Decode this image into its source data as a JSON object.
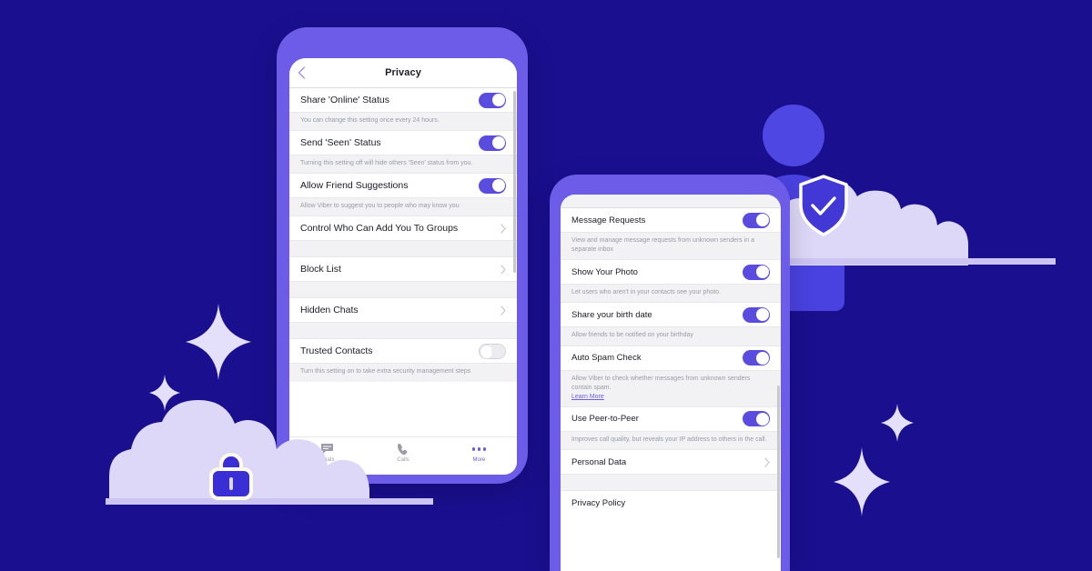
{
  "theme": {
    "background": "#1a0f8f",
    "phone_frame": "#6c5ce7",
    "accent": "#5b4ce0",
    "cloud": "#ddd8f7",
    "avatar": "#4f47e3",
    "link": "#6c5ce7"
  },
  "decorations": {
    "shield_icon": "shield-check-icon",
    "lock_icon": "lock-icon",
    "avatar_icon": "person-avatar-icon",
    "cloud_left": "cloud-shape",
    "cloud_right": "cloud-shape",
    "sparkles": [
      "sparkle-large-left",
      "sparkle-small-left",
      "sparkle-large-right",
      "sparkle-small-right"
    ]
  },
  "phone_one": {
    "header": {
      "back_icon": "chevron-left-icon",
      "title": "Privacy"
    },
    "rows": [
      {
        "type": "toggle",
        "label": "Share 'Online' Status",
        "state": "on",
        "desc": "You can change this setting once every 24 hours."
      },
      {
        "type": "toggle",
        "label": "Send 'Seen' Status",
        "state": "on",
        "desc": "Turning this setting off will hide others 'Seen' status from you."
      },
      {
        "type": "toggle",
        "label": "Allow Friend Suggestions",
        "state": "on",
        "desc": "Allow Viber to suggest you to people who may know you"
      },
      {
        "type": "link",
        "label": "Control Who Can Add You To Groups",
        "desc": ""
      },
      {
        "type": "link",
        "label": "Block List",
        "desc": ""
      },
      {
        "type": "link",
        "label": "Hidden Chats",
        "desc": ""
      },
      {
        "type": "toggle",
        "label": "Trusted Contacts",
        "state": "off",
        "desc": "Turn this setting on to take extra security management steps"
      }
    ],
    "tabbar": [
      {
        "label": "Chats",
        "icon": "chat-bubble-icon",
        "active": false
      },
      {
        "label": "Calls",
        "icon": "phone-handset-icon",
        "active": false
      },
      {
        "label": "More",
        "icon": "more-dots-icon",
        "active": true
      }
    ]
  },
  "phone_two": {
    "rows": [
      {
        "type": "toggle",
        "label": "Message Requests",
        "state": "on",
        "desc": "View and manage message requests from unknown senders in a separate inbox"
      },
      {
        "type": "toggle",
        "label": "Show Your Photo",
        "state": "on",
        "desc": "Let users who aren't in your contacts see your photo."
      },
      {
        "type": "toggle",
        "label": "Share your birth date",
        "state": "on",
        "desc": "Allow friends to be notified on your birthday"
      },
      {
        "type": "toggle",
        "label": "Auto Spam Check",
        "state": "on",
        "desc": "Allow Viber to check whether messages from unknown senders contain spam.",
        "link_text": "Learn More"
      },
      {
        "type": "toggle",
        "label": "Use Peer-to-Peer",
        "state": "on",
        "desc": "Improves call quality, but reveals your IP address to others in the call."
      },
      {
        "type": "link",
        "label": "Personal Data",
        "desc": ""
      },
      {
        "type": "plain",
        "label": "Privacy Policy",
        "desc": ""
      }
    ]
  }
}
